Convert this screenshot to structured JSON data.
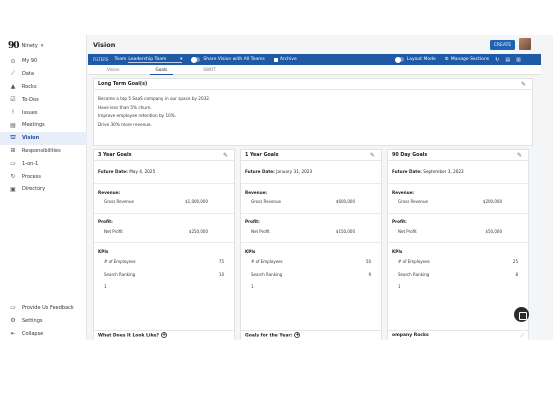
{
  "brand": {
    "logo": "90",
    "org": "Ninety",
    "caret": "▾"
  },
  "nav": {
    "items": [
      {
        "label": "My 90",
        "icon": "⊙"
      },
      {
        "label": "Data",
        "icon": "⟋"
      },
      {
        "label": "Rocks",
        "icon": "▲"
      },
      {
        "label": "To-Dos",
        "icon": "☑"
      },
      {
        "label": "Issues",
        "icon": "!"
      },
      {
        "label": "Meetings",
        "icon": "▤"
      },
      {
        "label": "Vision",
        "icon": "⛫"
      },
      {
        "label": "Responsibilities",
        "icon": "⊞"
      },
      {
        "label": "1-on-1",
        "icon": "▭"
      },
      {
        "label": "Process",
        "icon": "↻"
      },
      {
        "label": "Directory",
        "icon": "▣"
      }
    ],
    "bottom": [
      {
        "label": "Provide Us Feedback",
        "icon": "▭"
      },
      {
        "label": "Settings",
        "icon": "⚙"
      },
      {
        "label": "Collapse",
        "icon": "⇤"
      }
    ]
  },
  "header": {
    "title": "Vision",
    "create_label": "CREATE"
  },
  "filters": {
    "label": "FILTERS",
    "team_label": "Team",
    "team_value": "Leadership Team",
    "team_caret": "▾",
    "share_label": "Share Vision with All Teams",
    "archive_label": "Archive",
    "layout_label": "Layout Mode",
    "manage_label": "Manage Sections",
    "tool_icons": [
      "↻",
      "▤",
      "▥"
    ]
  },
  "tabs": [
    "Vision",
    "Goals",
    "SWOT"
  ],
  "long_term": {
    "title": "Long Term Goal(s)",
    "goals": [
      "Become a top 5 SaaS company in our space by 2032.",
      "Have less than 5% churn.",
      "Improve employee retention by 10%.",
      "Drive 30% more revenue."
    ]
  },
  "columns": [
    {
      "title": "3 Year Goals",
      "future_label": "Future Date:",
      "future_date": "May 4, 2025",
      "revenue_label": "Revenue:",
      "revenue_item": "Gross Revenue",
      "revenue_value": "$1,000,000",
      "profit_label": "Profit:",
      "profit_item": "Net Profit",
      "profit_value": "$250,000",
      "kpis_label": "KPIs",
      "kpis": [
        {
          "name": "# of Employees",
          "value": "75"
        },
        {
          "name": "Search Ranking",
          "value": "10"
        },
        {
          "name": "1",
          "value": ""
        }
      ],
      "footer": "What Does It Look Like?"
    },
    {
      "title": "1 Year Goals",
      "future_label": "Future Date:",
      "future_date": "January 31, 2023",
      "revenue_label": "Revenue:",
      "revenue_item": "Gross Revenue",
      "revenue_value": "$600,000",
      "profit_label": "Profit:",
      "profit_item": "Net Profit",
      "profit_value": "$150,000",
      "kpis_label": "KPIs",
      "kpis": [
        {
          "name": "# of Employees",
          "value": "50"
        },
        {
          "name": "Search Ranking",
          "value": "9"
        },
        {
          "name": "1",
          "value": ""
        }
      ],
      "footer": "Goals for the Year:"
    },
    {
      "title": "90 Day Goals",
      "future_label": "Future Date:",
      "future_date": "September 3, 2022",
      "revenue_label": "Revenue:",
      "revenue_item": "Gross Revenue",
      "revenue_value": "$200,000",
      "profit_label": "Profit:",
      "profit_item": "Net Profit",
      "profit_value": "$50,000",
      "kpis_label": "KPIs",
      "kpis": [
        {
          "name": "# of Employees",
          "value": "25"
        },
        {
          "name": "Search Ranking",
          "value": "8"
        },
        {
          "name": "1",
          "value": ""
        }
      ],
      "footer": "ompany Rocks"
    }
  ],
  "icons": {
    "edit": "✎",
    "plus": "+",
    "trend": "⟋"
  },
  "colors": {
    "accent": "#1f5aa6",
    "create": "#1f63b5",
    "active_bg": "#e8eef8",
    "trend": "#2ea36c"
  }
}
